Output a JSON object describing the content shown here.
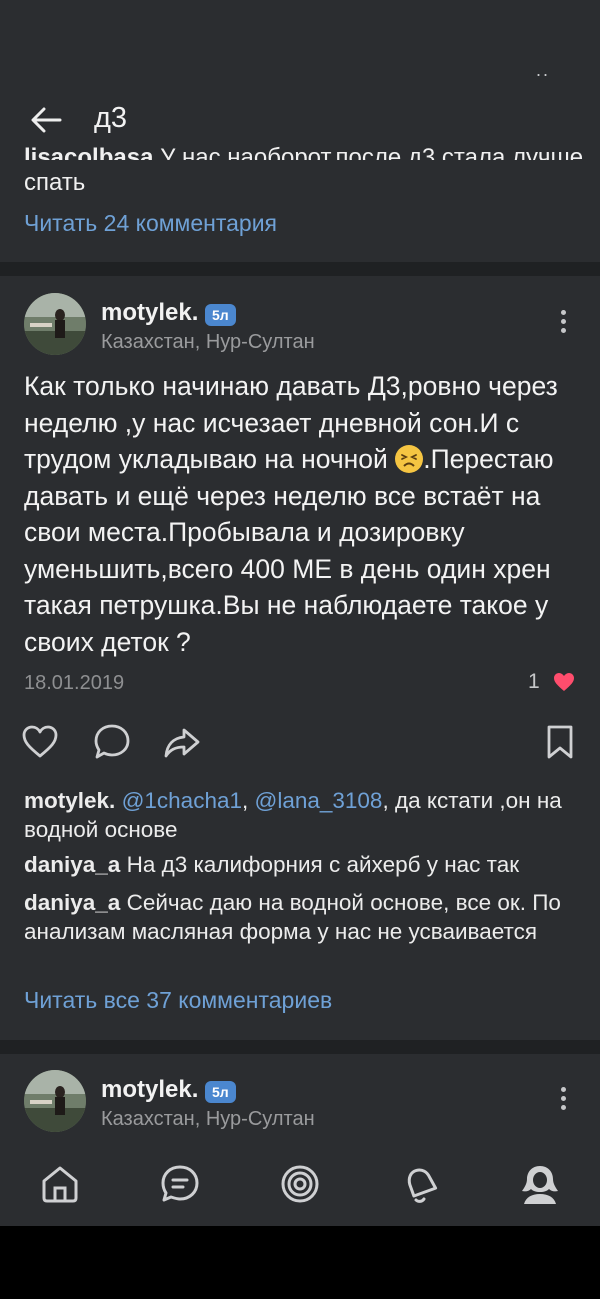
{
  "status": {
    "dots": ".."
  },
  "header": {
    "title": "д3",
    "back_icon": "arrow-left-icon"
  },
  "prev_post": {
    "cut_author": "lisacolbasa",
    "cut_text": " У нас наоборот,после д3 стала лучше",
    "continued_text": "спать",
    "read_comments": "Читать 24 комментария"
  },
  "post": {
    "author": "motylek.",
    "badge": "5л",
    "location": "Казахстан, Нур-Султан",
    "text_before_emoji": "Как только начинаю давать Д3,ровно через неделю ,у нас исчезает дневной сон.И с трудом укладываю на ночной ",
    "emoji_icon": "tired-face-icon",
    "text_after_emoji": ".Перестаю давать и ещё через неделю все встаёт на свои места.Пробывала и дозировку уменьшить,всего 400 МЕ в день один хрен такая петрушка.Вы не наблюдаете такое у своих деток ?",
    "date": "18.01.2019",
    "likes": "1",
    "like_color": "#ff4d6d"
  },
  "comments": [
    {
      "author": "motylek.",
      "mention1": "@1chacha1",
      "sep": ", ",
      "mention2": "@lana_3108",
      "text": ", да кстати ,он на водной основе"
    },
    {
      "author": "daniya_a",
      "text": " На д3 калифорния с айхерб у нас так"
    },
    {
      "author": "daniya_a",
      "text": " Сейчас даю на водной основе, все ок. По анализам масляная форма у нас не усваивается"
    }
  ],
  "read_all_comments": "Читать все 37 комментариев",
  "next_post": {
    "author": "motylek.",
    "badge": "5л",
    "location": "Казахстан, Нур-Султан"
  },
  "nav": {
    "items": [
      "home-icon",
      "messages-icon",
      "discover-icon",
      "notifications-icon",
      "profile-icon"
    ]
  },
  "colors": {
    "accent": "#6fa1d6",
    "background": "#2b2d30",
    "separator": "#1f2123",
    "badge": "#4b87cf"
  }
}
